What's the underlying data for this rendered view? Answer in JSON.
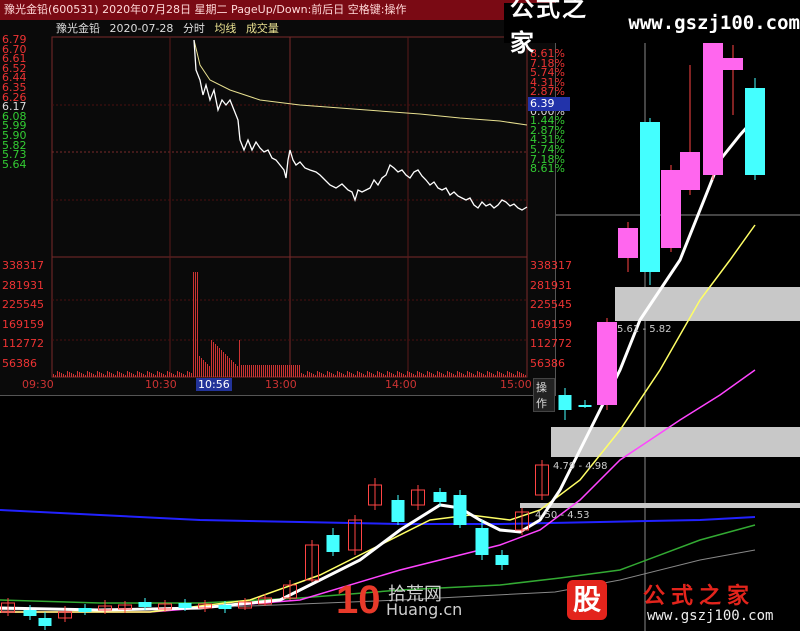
{
  "header": {
    "title": "豫光金铅(600531) 2020年07月28日 星期二 PageUp/Down:前后日 空格键:操作"
  },
  "intraday": {
    "name": "豫光金铅",
    "date": "2020-07-28",
    "mode": "分时",
    "avg_label": "均线",
    "vol_label": "成交量",
    "price_labels": [
      "6.79",
      "6.70",
      "6.61",
      "6.52",
      "6.44",
      "6.35",
      "6.26",
      "6.17",
      "6.08",
      "5.99",
      "5.90",
      "5.82",
      "5.73",
      "5.64"
    ],
    "pct_labels": [
      "8.61%",
      "7.18%",
      "5.74%",
      "4.31%",
      "2.87%",
      "1.44%",
      "0.00%",
      "1.44%",
      "2.87%",
      "4.31%",
      "5.74%",
      "7.18%",
      "8.61%"
    ],
    "vol_labels": [
      "338317",
      "281931",
      "225545",
      "169159",
      "112772",
      "56386"
    ],
    "current_value": "6.39",
    "time_labels": [
      "09:30",
      "10:30",
      "10:56",
      "13:00",
      "14:00",
      "15:00"
    ],
    "selected_time": "10:56",
    "op_button": "操作",
    "colors": {
      "up": "#e33",
      "down": "#3c3",
      "price_line": "#ffffff",
      "avg_line": "#e8e090",
      "volume": "#22cc22"
    }
  },
  "kline": {
    "range_labels": [
      "5.61 - 5.82",
      "4.79 - 4.98",
      "4.50 - 4.53"
    ],
    "colors": {
      "up": "#ff66ee",
      "down": "#44ffff",
      "ma5": "#ffffff",
      "ma10": "#ffff66",
      "ma20": "#ff44ff",
      "ma60": "#33ff33",
      "ma120": "#2222ff"
    }
  },
  "watermark": {
    "site_name": "公式之家",
    "site_url": "www.gszj100.com",
    "badge": "股",
    "site_url_bottom": "www.gszj100.com",
    "huang_big": "10",
    "huang_top": "拾荒网",
    "huang_bottom": "Huang.cn"
  }
}
